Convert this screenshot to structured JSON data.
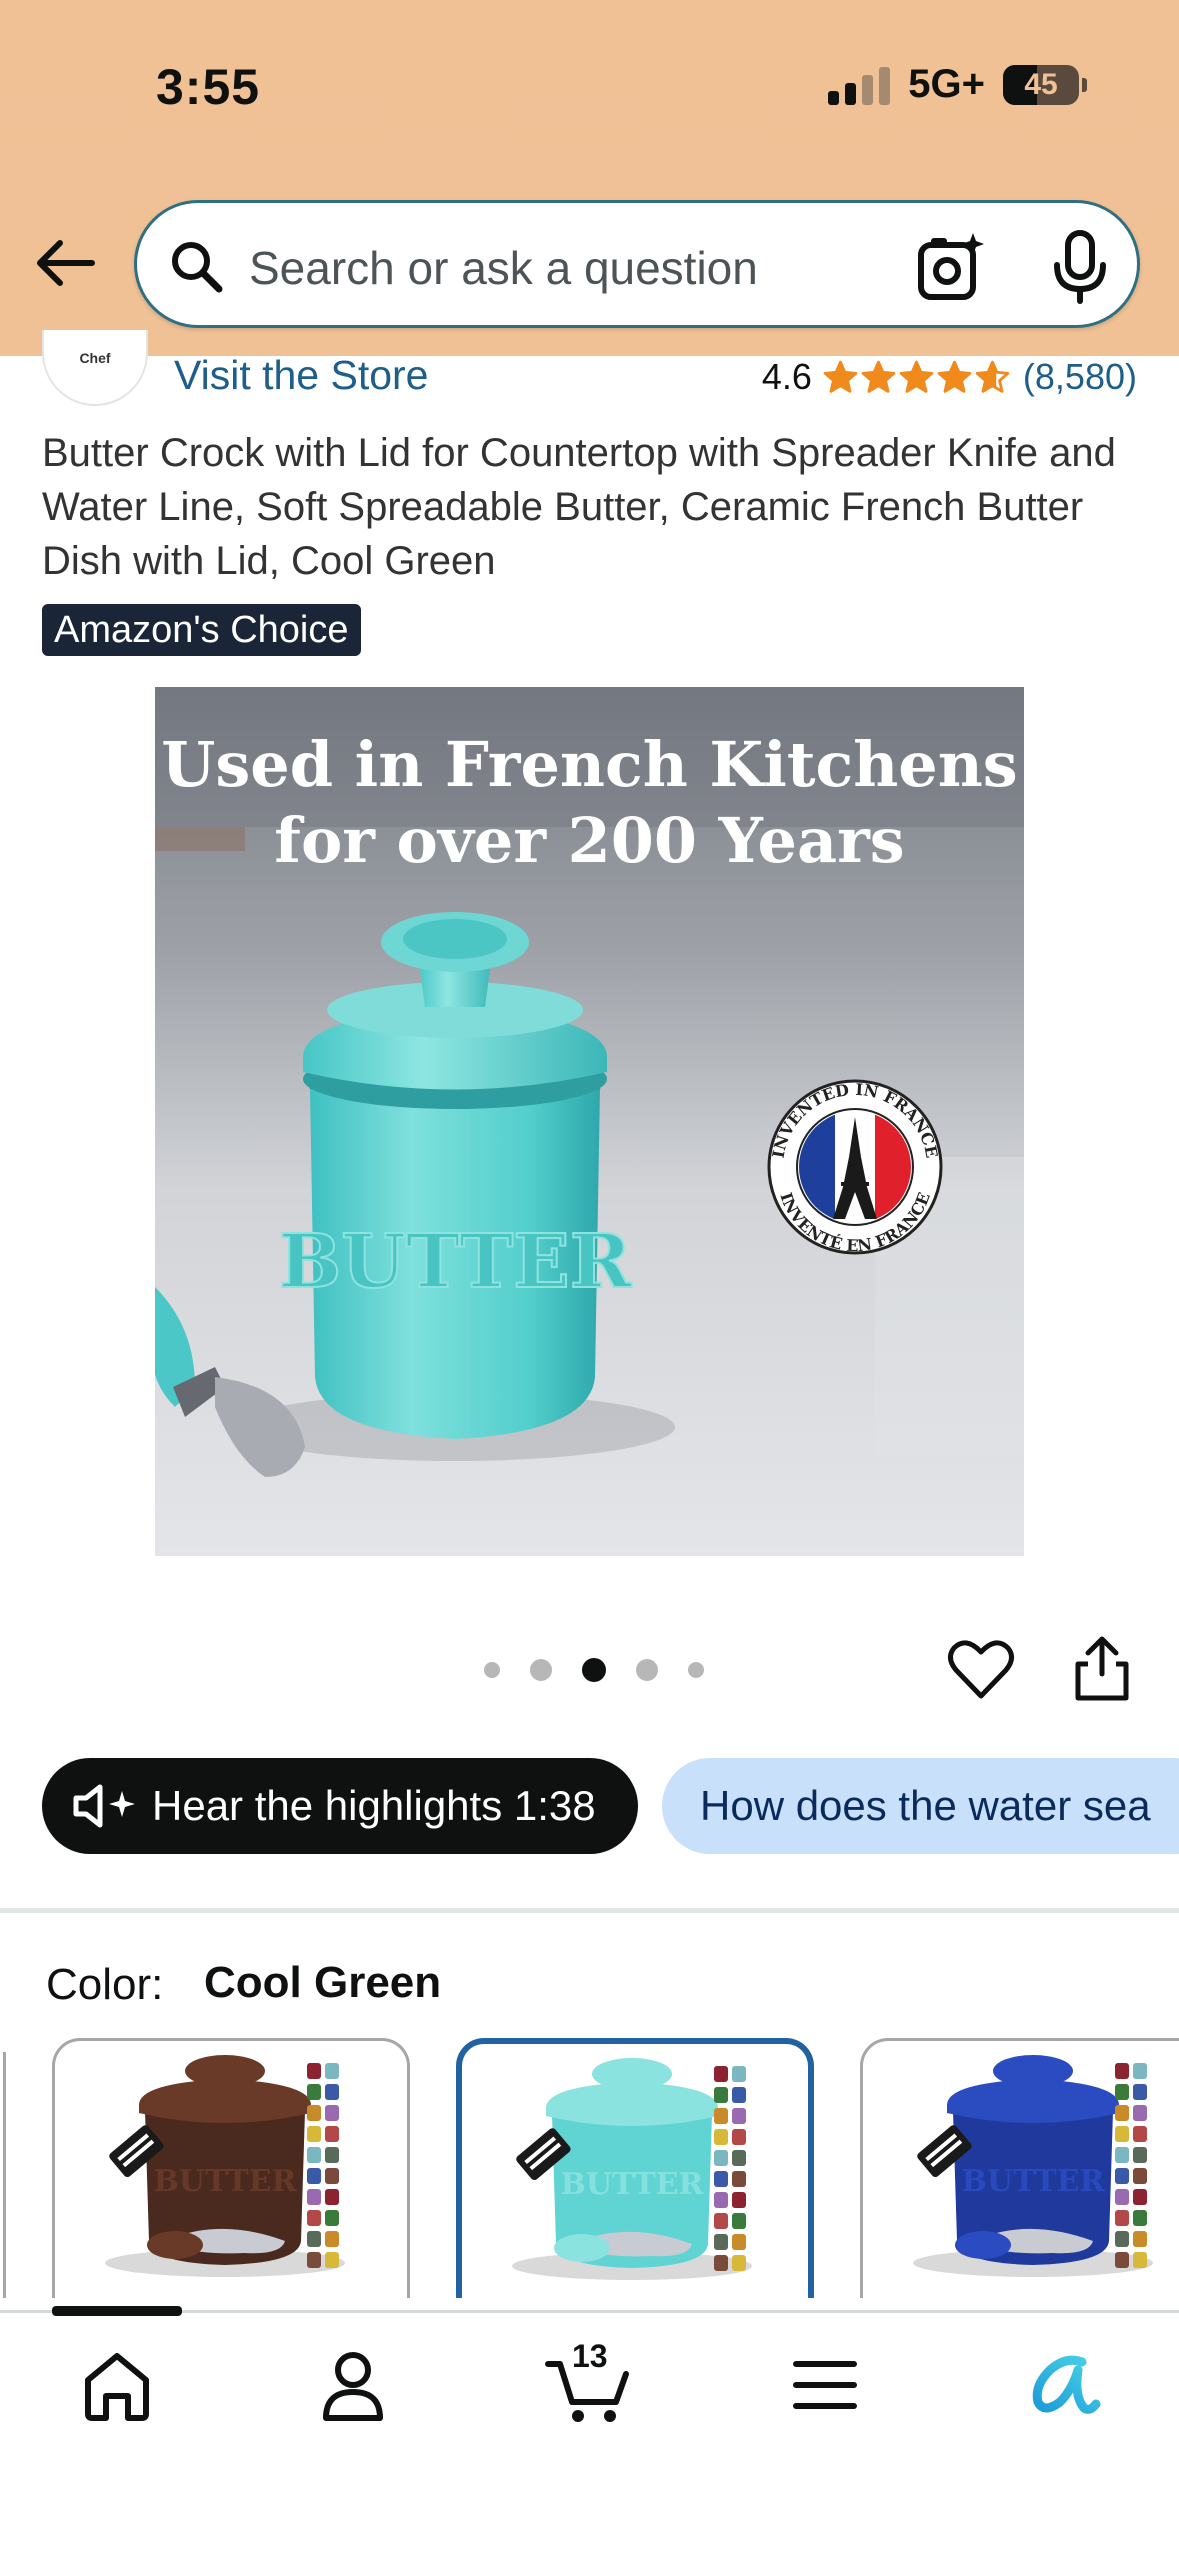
{
  "status_bar": {
    "time": "3:55",
    "network": "5G+",
    "battery": "45"
  },
  "search": {
    "placeholder": "Search or ask a question"
  },
  "store": {
    "logo_text": "Chef",
    "link": "Visit the Store",
    "rating": "4.6",
    "rating_value": 4.6,
    "rating_count": "(8,580)"
  },
  "product": {
    "title": "Butter Crock with Lid for Countertop with Spreader Knife and Water Line, Soft Spreadable Butter, Ceramic French Butter Dish with Lid, Cool Green",
    "badge": "Amazon's Choice",
    "image_headline_1": "Used in French Kitchens",
    "image_headline_2": "for over 200 Years",
    "crock_text": "BUTTER",
    "seal_top": "INVENTED IN FRANCE",
    "seal_bottom": "INVENTÉ EN FRANCE",
    "image_index": 3,
    "image_count": 5
  },
  "chips": {
    "highlights": "Hear the highlights 1:38",
    "question": "How does the water sea"
  },
  "color": {
    "label": "Color:",
    "selected": "Cool Green",
    "options": [
      {
        "swatch": "#4a2a1f",
        "accent": "#6a3a28",
        "selected": false
      },
      {
        "swatch": "#5fd4d3",
        "accent": "#8be3e0",
        "selected": true
      },
      {
        "swatch": "#1f3a9c",
        "accent": "#2a4cc0",
        "selected": false
      }
    ]
  },
  "nav": {
    "cart_count": "13"
  },
  "colors": {
    "header_bg": "#f1c196",
    "link": "#1e5f8a",
    "star": "#f08a1c",
    "selected_border": "#2162a1",
    "chip_light": "#c8e0fa"
  }
}
